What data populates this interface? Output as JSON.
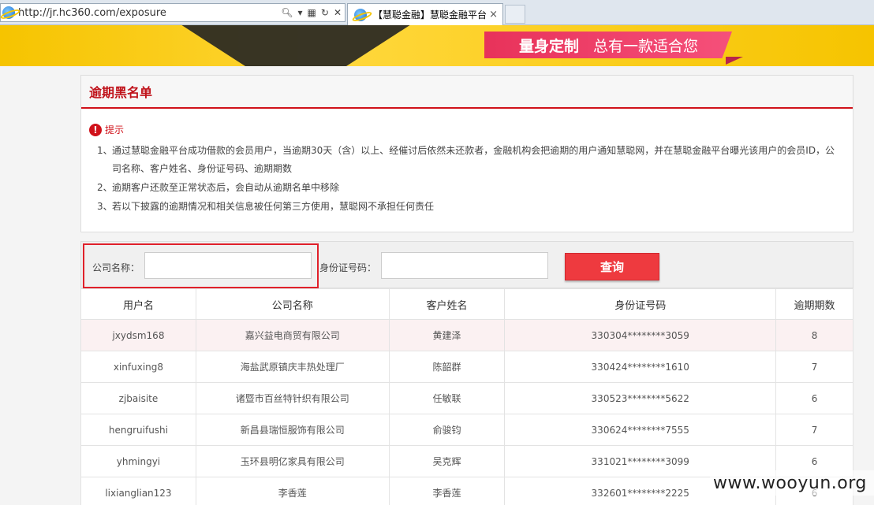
{
  "browser": {
    "url": "http://jr.hc360.com/exposure",
    "tab_title": "【慧聪金融】慧聪金融平台...",
    "tab_close": "×"
  },
  "banner": {
    "slogan_strong": "量身定制",
    "slogan_light": "总有一款适合您"
  },
  "notice": {
    "title": "逾期黑名单",
    "tip_label": "提示",
    "items": [
      {
        "num": "1、",
        "text": "通过慧聪金融平台成功借款的会员用户，当逾期30天（含）以上、经催讨后依然未还款者，金融机构会把逾期的用户通知慧聪网，并在慧聪金融平台曝光该用户的会员ID，公司名称、客户姓名、身份证号码、逾期期数"
      },
      {
        "num": "2、",
        "text": "逾期客户还款至正常状态后，会自动从逾期名单中移除"
      },
      {
        "num": "3、",
        "text": "若以下披露的逾期情况和相关信息被任何第三方使用，慧聪网不承担任何责任"
      }
    ]
  },
  "search": {
    "company_label": "公司名称：",
    "company_value": "",
    "id_label": "身份证号码：",
    "id_value": "",
    "query_button": "查询"
  },
  "table": {
    "headers": [
      "用户名",
      "公司名称",
      "客户姓名",
      "身份证号码",
      "逾期期数"
    ],
    "rows": [
      [
        "jxydsm168",
        "嘉兴益电商贸有限公司",
        "黄建泽",
        "330304********3059",
        "8"
      ],
      [
        "xinfuxing8",
        "海盐武原镇庆丰热处理厂",
        "陈韶群",
        "330424********1610",
        "7"
      ],
      [
        "zjbaisite",
        "诸暨市百丝特针织有限公司",
        "任敏联",
        "330523********5622",
        "6"
      ],
      [
        "hengruifushi",
        "新昌县瑞恒服饰有限公司",
        "俞骏钧",
        "330624********7555",
        "7"
      ],
      [
        "yhmingyi",
        "玉环县明亿家具有限公司",
        "吴克辉",
        "331021********3099",
        "6"
      ],
      [
        "lixianglian123",
        "李香莲",
        "李香莲",
        "332601********2225",
        "6"
      ]
    ]
  },
  "watermark": "www.wooyun.org"
}
